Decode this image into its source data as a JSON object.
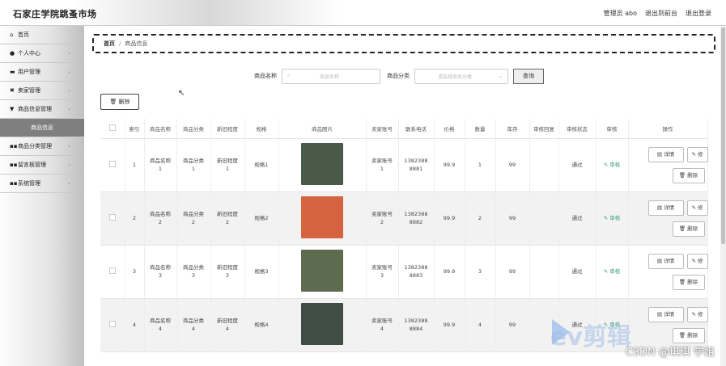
{
  "header": {
    "site_title": "石家庄学院跳蚤市场",
    "admin_label": "管理员 abo",
    "back_label": "退出到前台",
    "logout_label": "退出登录"
  },
  "sidebar": {
    "items": [
      {
        "icon": "home-icon",
        "glyph": "⌂",
        "label": "首页",
        "chevron": false
      },
      {
        "icon": "user-icon",
        "glyph": "●",
        "label": "个人中心",
        "chevron": true
      },
      {
        "icon": "users-icon",
        "glyph": "▬",
        "label": "用户管理",
        "chevron": true
      },
      {
        "icon": "seller-icon",
        "glyph": "✖",
        "label": "卖家管理",
        "chevron": true
      },
      {
        "icon": "goods-icon",
        "glyph": "▼",
        "label": "商品信息管理",
        "chevron": true
      },
      {
        "icon": "",
        "glyph": "",
        "label": "商品信息",
        "chevron": false,
        "sub": true
      },
      {
        "icon": "grid-icon",
        "glyph": "▪▪",
        "label": "商品分类管理",
        "chevron": true
      },
      {
        "icon": "grid-icon",
        "glyph": "▪▪",
        "label": "留言板管理",
        "chevron": true
      },
      {
        "icon": "grid-icon",
        "glyph": "▪▪",
        "label": "系统管理",
        "chevron": true
      }
    ]
  },
  "breadcrumb": {
    "home": "首页",
    "separator": "/",
    "current": "商品信息"
  },
  "search": {
    "name_label": "商品名称",
    "name_placeholder": "商品名称",
    "category_label": "商品分类",
    "category_placeholder": "请选择商品分类",
    "query_label": "查询"
  },
  "toolbar": {
    "delete_label": "🗑 删除"
  },
  "table": {
    "headers": [
      "",
      "索引",
      "商品名称",
      "商品分类",
      "新旧程度",
      "规格",
      "商品图片",
      "卖家账号",
      "联系电话",
      "价格",
      "数量",
      "库存",
      "审核回复",
      "审核状态",
      "审核",
      "操作"
    ],
    "rows": [
      {
        "index": "1",
        "name": "商品名称\n1",
        "category": "商品分类\n1",
        "condition": "新旧程度\n1",
        "spec": "规格1",
        "seller": "卖家账号\n1",
        "phone": "1382388\n8881",
        "price": "99.9",
        "qty": "1",
        "stock": "99",
        "reply": "",
        "status": "通过",
        "audit": "✎ 审核",
        "img_color": "#4a5a48"
      },
      {
        "index": "2",
        "name": "商品名称\n2",
        "category": "商品分类\n2",
        "condition": "新旧程度\n2",
        "spec": "规格2",
        "seller": "卖家账号\n2",
        "phone": "1382388\n8882",
        "price": "99.9",
        "qty": "2",
        "stock": "99",
        "reply": "",
        "status": "通过",
        "audit": "✎ 审核",
        "img_color": "#d5633f"
      },
      {
        "index": "3",
        "name": "商品名称\n3",
        "category": "商品分类\n3",
        "condition": "新旧程度\n3",
        "spec": "规格3",
        "seller": "卖家账号\n3",
        "phone": "1382388\n8883",
        "price": "99.9",
        "qty": "3",
        "stock": "99",
        "reply": "",
        "status": "通过",
        "audit": "✎ 审核",
        "img_color": "#5d6b4f"
      },
      {
        "index": "4",
        "name": "商品名称\n4",
        "category": "商品分类\n4",
        "condition": "新旧程度\n4",
        "spec": "规格4",
        "seller": "卖家账号\n4",
        "phone": "1382388\n8884",
        "price": "99.9",
        "qty": "4",
        "stock": "99",
        "reply": "",
        "status": "通过",
        "audit": "✎ 审核",
        "img_color": "#3f4d44"
      }
    ],
    "detail_label": "▤ 详情",
    "edit_label": "✎ 修",
    "delete_label": "🗑 删除"
  },
  "watermark": {
    "text": "ev剪辑",
    "credit": "CSDN @琪琪 学姐"
  }
}
